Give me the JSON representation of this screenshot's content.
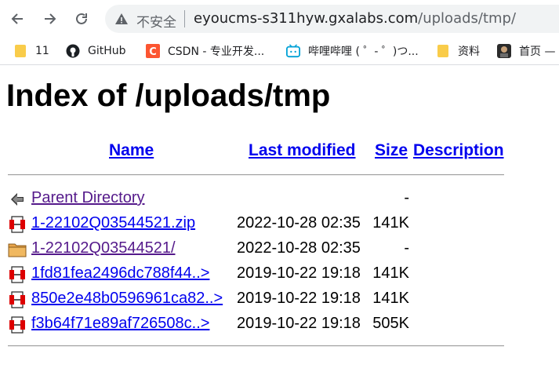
{
  "browser": {
    "insecure_label": "不安全",
    "url_host": "eyoucms-s311hyw.gxalabs.com",
    "url_path": "/uploads/tmp/"
  },
  "bookmarks": [
    {
      "label": "11",
      "icon": "folder-icon"
    },
    {
      "label": "GitHub",
      "icon": "github-icon"
    },
    {
      "label": "CSDN - 专业开发...",
      "icon": "csdn-icon"
    },
    {
      "label": "哔哩哔哩 ( ゜- ゜)つ...",
      "icon": "bilibili-icon"
    },
    {
      "label": "资料",
      "icon": "folder-icon"
    },
    {
      "label": "首页 —",
      "icon": "avatar-icon"
    }
  ],
  "page": {
    "title": "Index of /uploads/tmp"
  },
  "table": {
    "headers": {
      "name": "Name",
      "modified": "Last modified",
      "size": "Size",
      "description": "Description"
    },
    "rows": [
      {
        "name": "Parent Directory",
        "date": "",
        "size": "-",
        "icon": "back-icon",
        "visited": true
      },
      {
        "name": "1-22102Q03544521.zip",
        "date": "2022-10-28 02:35",
        "size": "141K",
        "icon": "file-icon",
        "visited": false
      },
      {
        "name": "1-22102Q03544521/",
        "date": "2022-10-28 02:35",
        "size": "-",
        "icon": "folder-icon",
        "visited": true
      },
      {
        "name": "1fd81fea2496dc788f44..>",
        "date": "2019-10-22 19:18",
        "size": "141K",
        "icon": "file-icon",
        "visited": false
      },
      {
        "name": "850e2e48b0596961ca82..>",
        "date": "2019-10-22 19:18",
        "size": "141K",
        "icon": "file-icon",
        "visited": false
      },
      {
        "name": "f3b64f71e89af726508c..>",
        "date": "2019-10-22 19:18",
        "size": "505K",
        "icon": "file-icon",
        "visited": false
      }
    ]
  }
}
